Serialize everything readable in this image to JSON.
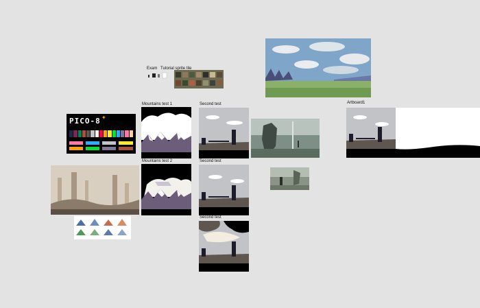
{
  "frames": {
    "example_label": "Exam",
    "tutorial_label": "Tutorial sprite tile",
    "mountains1_label": "Mountains test 1",
    "mountains2_label": "Mountains test 2",
    "second_test_a": "Second test",
    "second_test_b": "Second test",
    "second_test_c": "Second test",
    "artboard_label": "Artboard1"
  },
  "pico8": {
    "logo": "PICO-8",
    "palette": [
      "#000000",
      "#1d2b53",
      "#7e2553",
      "#008751",
      "#ab5236",
      "#5f574f",
      "#c2c3c7",
      "#fff1e8",
      "#ff004d",
      "#ffa300",
      "#ffec27",
      "#00e436",
      "#29adff",
      "#83769c",
      "#ff77a8",
      "#ffccaa"
    ]
  },
  "colors": {
    "canvas_bg": "#e3e3e3",
    "test_sky": "#c2c3c7",
    "test_ground": "#5f574f",
    "dark_frame": "#000000"
  }
}
